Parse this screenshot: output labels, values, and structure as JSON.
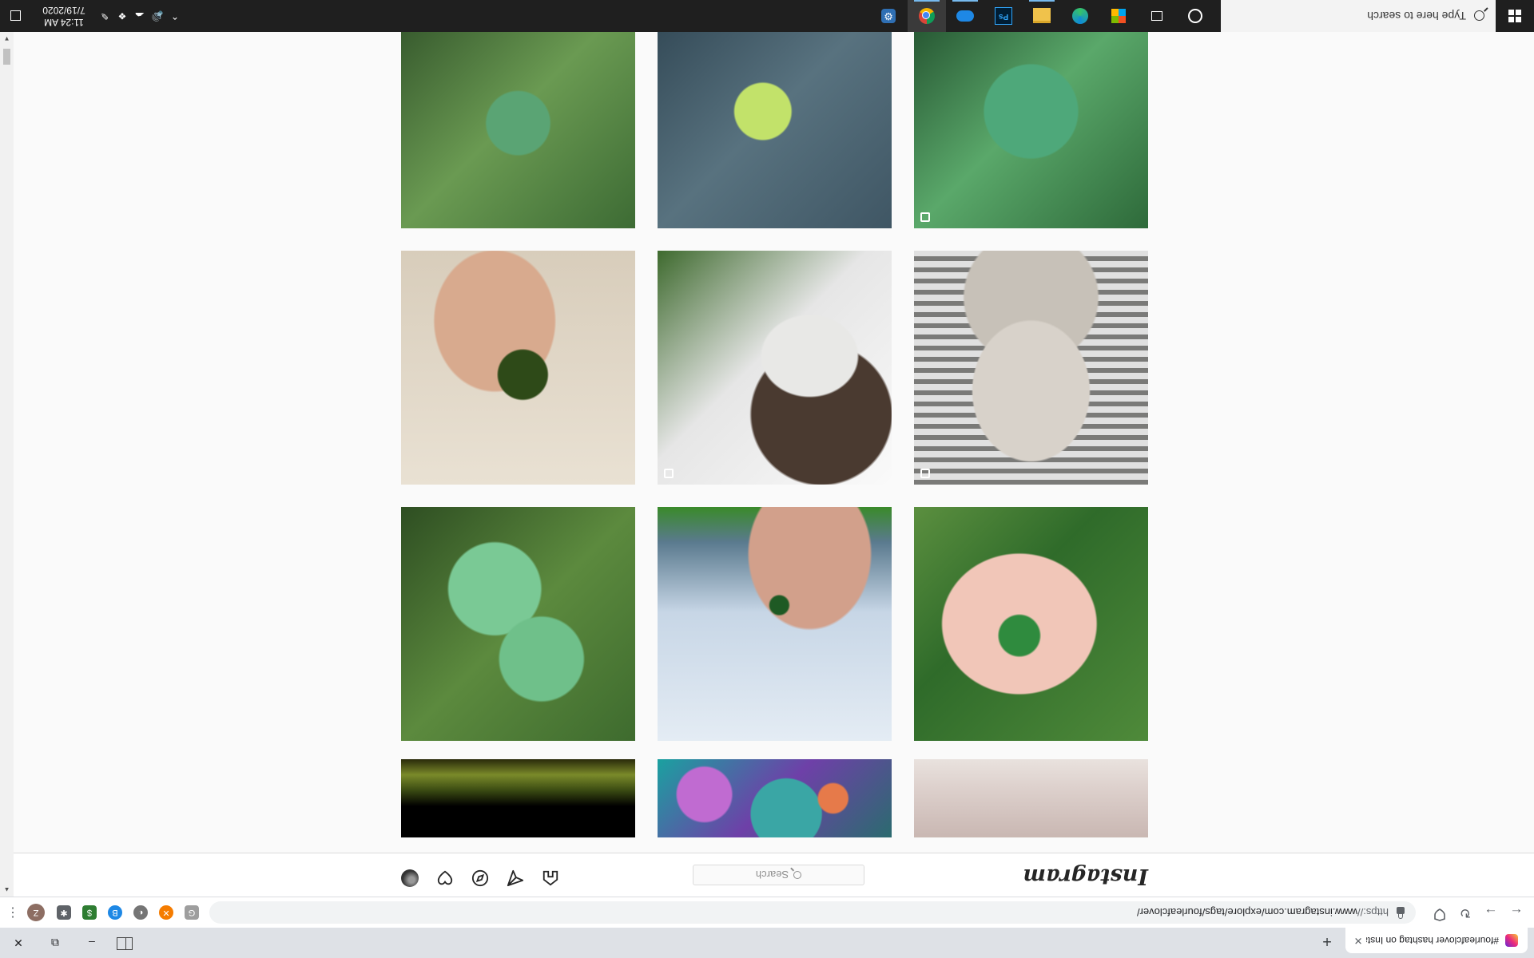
{
  "browser": {
    "tab_title": "#fourleafclover hashtag on Insta...",
    "tab_close": "✕",
    "new_tab": "+",
    "window_controls": {
      "minimize": "–",
      "restore": "⧉",
      "close": "✕"
    },
    "nav": {
      "back": "←",
      "forward": "→",
      "reload": "↻",
      "bookmark_icon": "shield-icon"
    },
    "url_scheme": "https://",
    "url_rest": "www.instagram.com/explore/tags/fourleafclover/",
    "extensions": [
      "G",
      "✕",
      "◐",
      "B",
      "$",
      "✱"
    ],
    "profile_initial": "Z",
    "menu": "⋮"
  },
  "instagram": {
    "logo": "Instagram",
    "search_placeholder": "Search",
    "nav_icons": [
      "home-icon",
      "direct-icon",
      "explore-icon",
      "activity-icon",
      "profile-avatar"
    ]
  },
  "posts": [
    {
      "alt": "tattoo on wrist",
      "multi": false
    },
    {
      "alt": "fish in colorful coral",
      "multi": false
    },
    {
      "alt": "moss at night",
      "multi": false
    },
    {
      "alt": "four leaf clover in palm with ring",
      "multi": false
    },
    {
      "alt": "hand holding clover against sky",
      "multi": false
    },
    {
      "alt": "clover patch",
      "multi": false
    },
    {
      "alt": "stone statue with roses",
      "multi": true
    },
    {
      "alt": "person with mask",
      "multi": true
    },
    {
      "alt": "dark four leaf clover held in fingers",
      "multi": false
    },
    {
      "alt": "four leaf clover in grass",
      "multi": true
    },
    {
      "alt": "yellow clover on leather",
      "multi": false
    },
    {
      "alt": "clover and weeds",
      "multi": false
    }
  ],
  "taskbar": {
    "search_placeholder": "Type here to search",
    "time": "11:24 AM",
    "date": "7/19/2020",
    "apps": [
      "cortana-icon",
      "task-view-icon",
      "microsoft-store-icon",
      "edge-icon",
      "file-explorer-icon",
      "photoshop-icon",
      "onedrive-icon",
      "chrome-icon",
      "settings-icon"
    ],
    "photoshop_label": "Ps"
  },
  "colors": {
    "ig_border": "#dbdbdb",
    "taskbar": "#1f1f1f",
    "accent": "#76b9ed"
  }
}
